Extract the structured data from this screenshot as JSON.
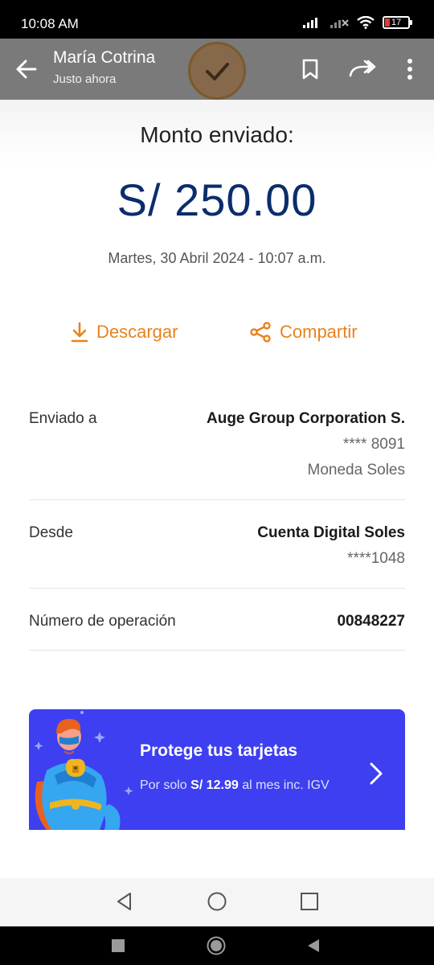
{
  "status_bar": {
    "time": "10:08 AM",
    "battery": "17",
    "icons": [
      "signal-icon",
      "signal-off-icon",
      "wifi-icon",
      "battery-icon"
    ]
  },
  "app_bar": {
    "title": "María Cotrina",
    "subtitle": "Justo ahora",
    "icons": [
      "back-arrow-icon",
      "check-circle-icon",
      "bookmark-icon",
      "forward-icon",
      "more-vert-icon"
    ]
  },
  "receipt": {
    "label": "Monto enviado:",
    "amount": "S/ 250.00",
    "datetime": "Martes, 30 Abril 2024 - 10:07 a.m.",
    "actions": {
      "download": "Descargar",
      "share": "Compartir"
    },
    "details": {
      "sent_to_label": "Enviado a",
      "sent_to_name": "Auge Group Corporation S.",
      "sent_to_account": "**** 8091",
      "sent_to_currency": "Moneda Soles",
      "from_label": "Desde",
      "from_account_name": "Cuenta Digital Soles",
      "from_account_number": "****1048",
      "operation_label": "Número de operación",
      "operation_number": "00848227"
    }
  },
  "banner": {
    "title": "Protege tus tarjetas",
    "sub_prefix": "Por solo",
    "sub_price": "S/ 12.99",
    "sub_suffix": "al mes inc. IGV"
  },
  "colors": {
    "amount": "#0b2d6b",
    "accent_orange": "#e8821e",
    "banner_blue": "#3d3ff0",
    "app_bar": "#7a7a7a"
  }
}
